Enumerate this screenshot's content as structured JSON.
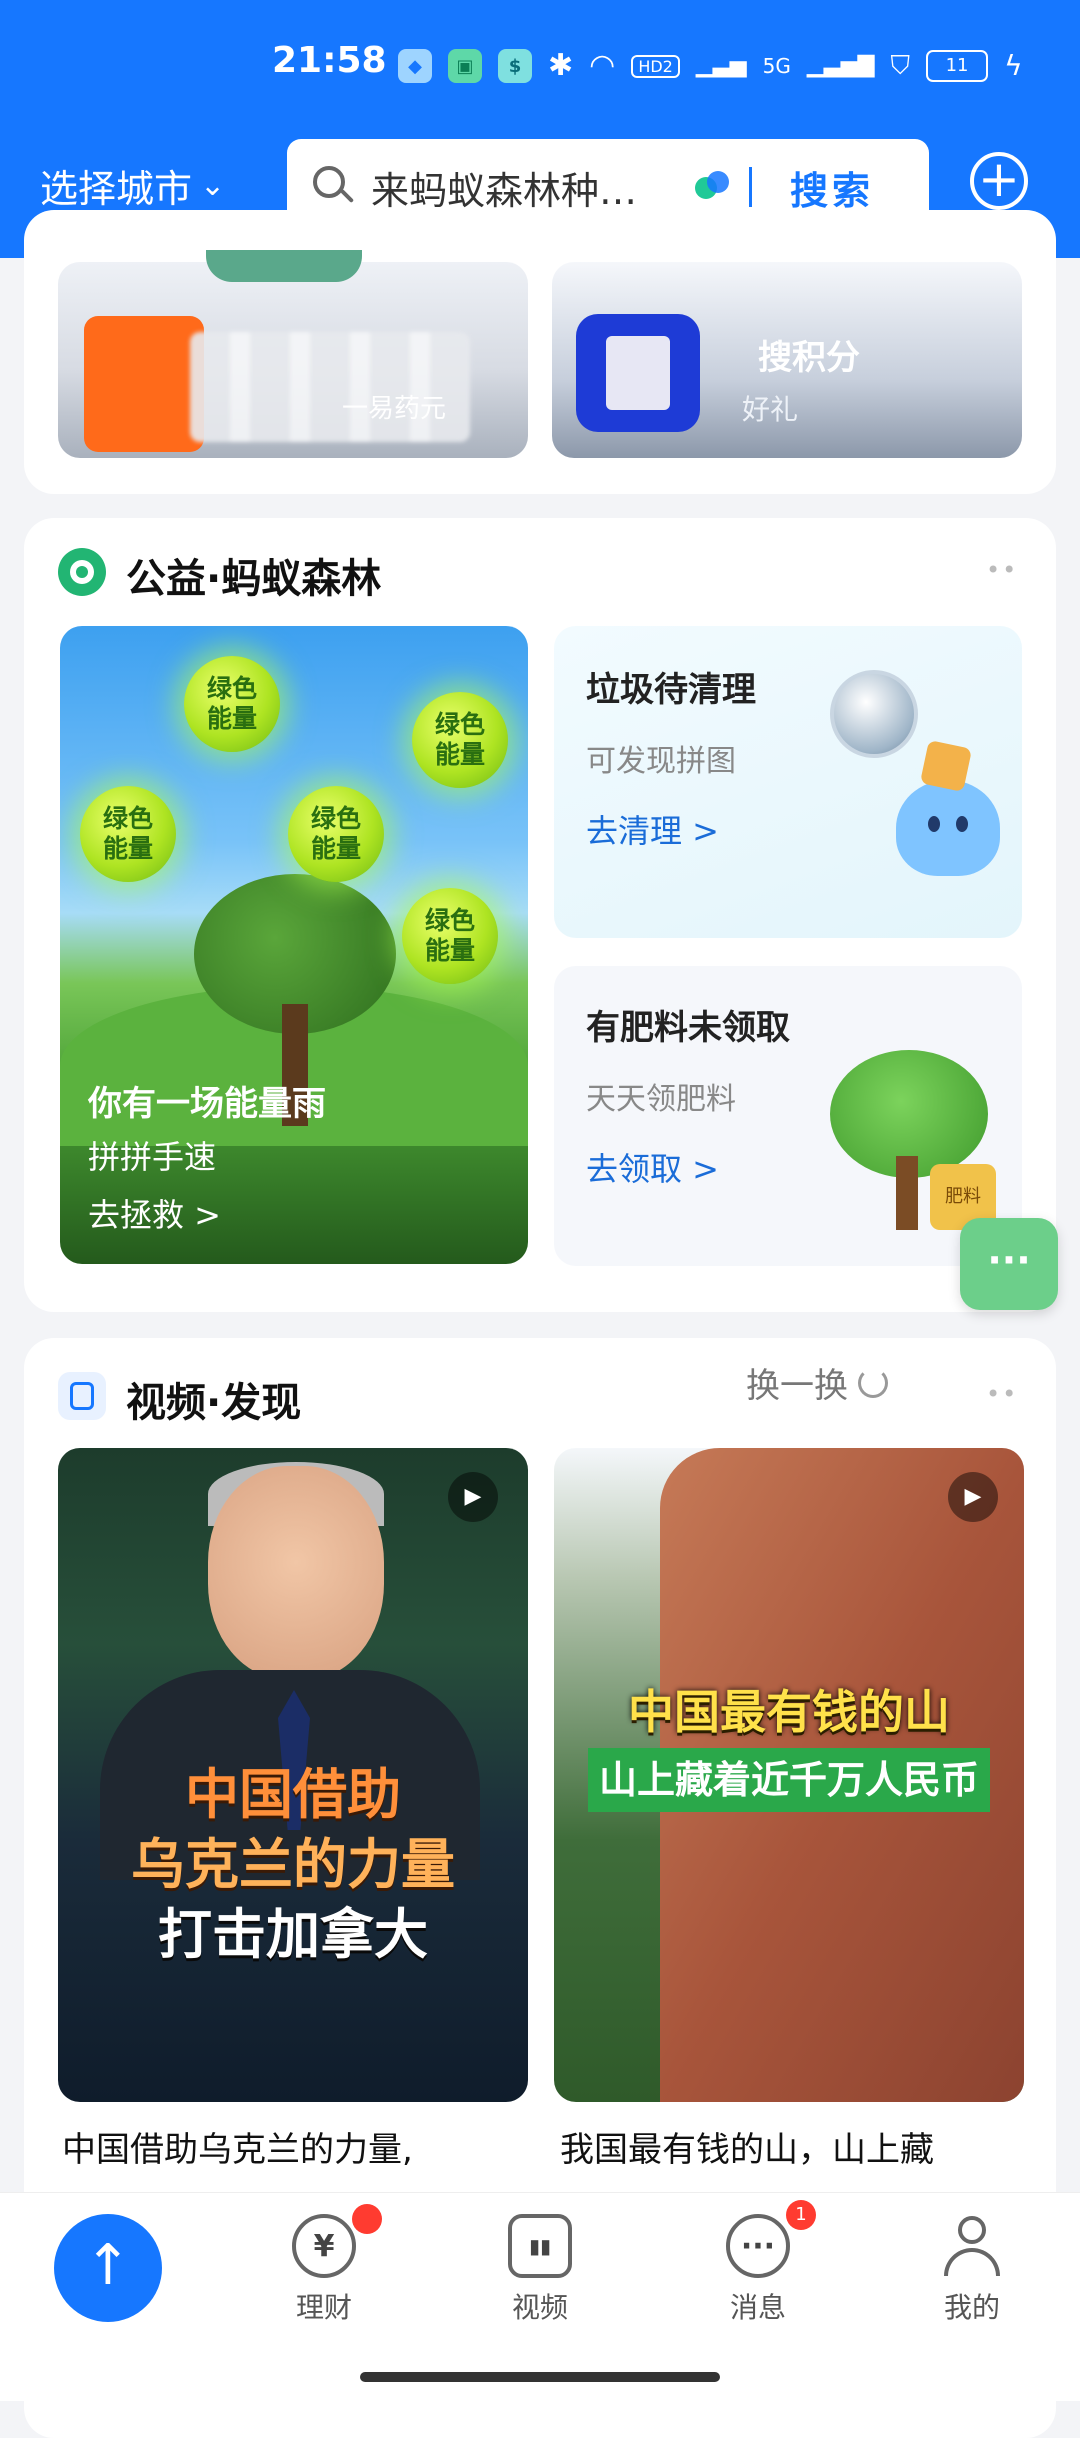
{
  "status_bar": {
    "time": "21:58",
    "network": "5G",
    "hd": "HD2",
    "battery": "11"
  },
  "header": {
    "city_label": "选择城市",
    "search_placeholder": "来蚂蚁森林种…",
    "search_button": "搜索"
  },
  "top_tiles": {
    "right_title": "搜积分",
    "right_sub": "好礼",
    "left_sub": "一易药元"
  },
  "forest_section": {
    "title": "公益·蚂蚁森林",
    "energy_bubble": "绿色\n能量",
    "main_card": {
      "title": "你有一场能量雨",
      "subtitle": "拼拼手速",
      "link": "去拯救 >"
    },
    "cards": [
      {
        "title": "垃圾待清理",
        "subtitle": "可发现拼图",
        "link": "去清理 >"
      },
      {
        "title": "有肥料未领取",
        "subtitle": "天天领肥料",
        "link": "去领取 >"
      }
    ],
    "fertilizer_label": "肥料"
  },
  "video_section": {
    "title": "视频·发现",
    "swap_label": "换一换",
    "videos": [
      {
        "caption_lines": [
          "中国借助",
          "乌克兰的力量",
          "打击加拿大"
        ],
        "title_line1": "中国借助乌克兰的力量,"
      },
      {
        "caption_line1": "中国最有钱的山",
        "caption_line2": "山上藏着近千万人民币",
        "title_line1": "我国最有钱的山，山上藏"
      }
    ]
  },
  "bottom_nav": {
    "items": [
      {
        "label": "理财",
        "icon": "¥",
        "badge": ""
      },
      {
        "label": "视频",
        "icon": "▮▮",
        "badge": ""
      },
      {
        "label": "消息",
        "icon": "···",
        "badge": "1"
      },
      {
        "label": "我的",
        "icon": "",
        "badge": ""
      }
    ]
  },
  "colors": {
    "brand_blue": "#1677ff",
    "badge_red": "#ff3b30",
    "link_blue": "#1a6cd8"
  }
}
